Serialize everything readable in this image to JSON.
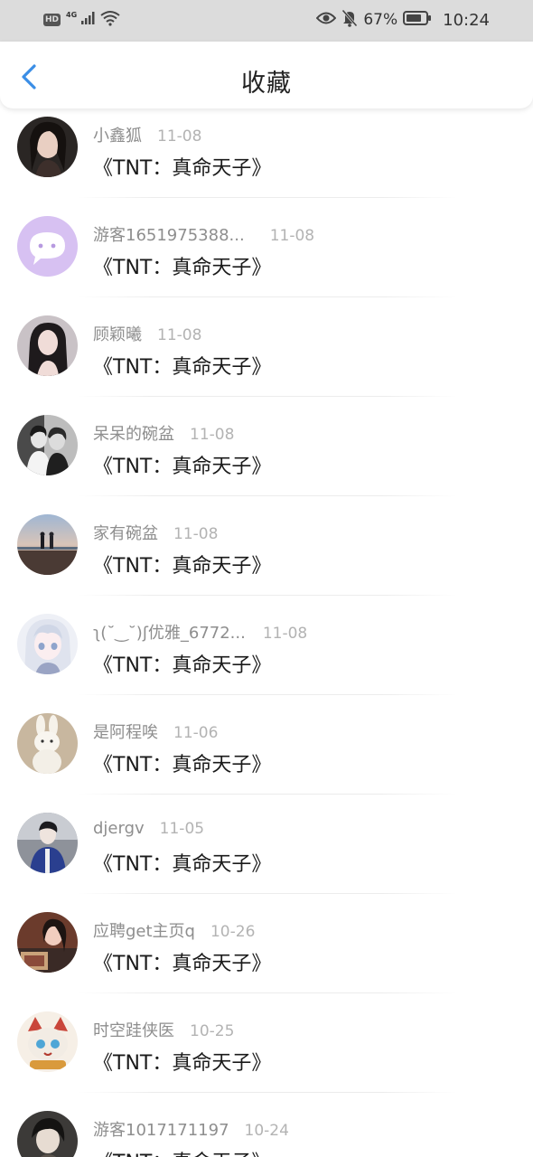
{
  "status_bar": {
    "hd": "HD",
    "network": "4G",
    "battery_percent": "67%",
    "time": "10:24",
    "icons": [
      "signal-icon",
      "wifi-icon",
      "eye-icon",
      "mute-bell-icon",
      "battery-icon"
    ]
  },
  "nav": {
    "back_icon": "chevron-left-icon",
    "title": "收藏",
    "accent_color": "#3a8ee6"
  },
  "favorites": [
    {
      "user": "小鑫狐",
      "date": "11-08",
      "title": "《TNT：真命天子》",
      "avatar": "photo-portrait-dark"
    },
    {
      "user": "游客1651975388...",
      "date": "11-08",
      "title": "《TNT：真命天子》",
      "avatar": "purple-chat-bubble"
    },
    {
      "user": "顾颖曦",
      "date": "11-08",
      "title": "《TNT：真命天子》",
      "avatar": "photo-portrait-dark"
    },
    {
      "user": "呆呆的碗盆",
      "date": "11-08",
      "title": "《TNT：真命天子》",
      "avatar": "photo-monochrome-couple"
    },
    {
      "user": "家有碗盆",
      "date": "11-08",
      "title": "《TNT：真命天子》",
      "avatar": "photo-sea-sunset"
    },
    {
      "user": "ʅ(˘‿˘)ʃ优雅_6772...",
      "date": "11-08",
      "title": "《TNT：真命天子》",
      "avatar": "anime-girl-light"
    },
    {
      "user": "是阿程唉",
      "date": "11-06",
      "title": "《TNT：真命天子》",
      "avatar": "plush-rabbit"
    },
    {
      "user": "djergv",
      "date": "11-05",
      "title": "《TNT：真命天子》",
      "avatar": "photo-person-blue"
    },
    {
      "user": "应聘get主页q",
      "date": "10-26",
      "title": "《TNT：真命天子》",
      "avatar": "photo-warm-portrait"
    },
    {
      "user": "时空跬侠医",
      "date": "10-25",
      "title": "《TNT：真命天子》",
      "avatar": "cartoon-cat"
    },
    {
      "user": "游客1017171197",
      "date": "10-24",
      "title": "《TNT：真命天子》",
      "avatar": "photo-dark-anime"
    }
  ]
}
